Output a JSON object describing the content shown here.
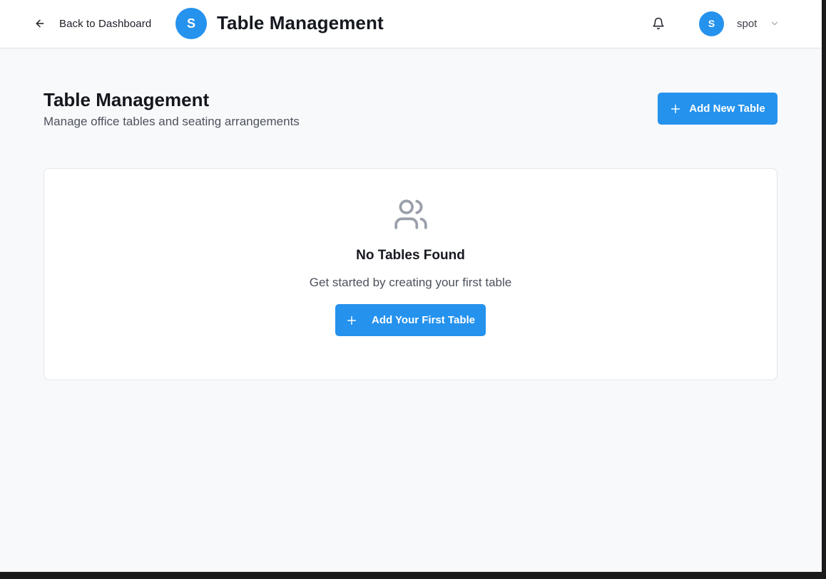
{
  "header": {
    "back_label": "Back to Dashboard",
    "brand_initial": "S",
    "app_title": "Table Management",
    "user": {
      "initial": "S",
      "name": "spot"
    }
  },
  "page": {
    "heading": "Table Management",
    "subtitle": "Manage office tables and seating arrangements",
    "add_button_label": "Add New Table"
  },
  "empty_state": {
    "title": "No Tables Found",
    "description": "Get started by creating your first table",
    "button_label": "Add Your First Table"
  },
  "icons": [
    "arrow-left-icon",
    "bell-icon",
    "chevron-down-icon",
    "plus-icon",
    "users-icon"
  ],
  "colors": {
    "accent": "#2592ee",
    "background": "#f8f9fb",
    "muted_icon": "#9aa0aa"
  }
}
